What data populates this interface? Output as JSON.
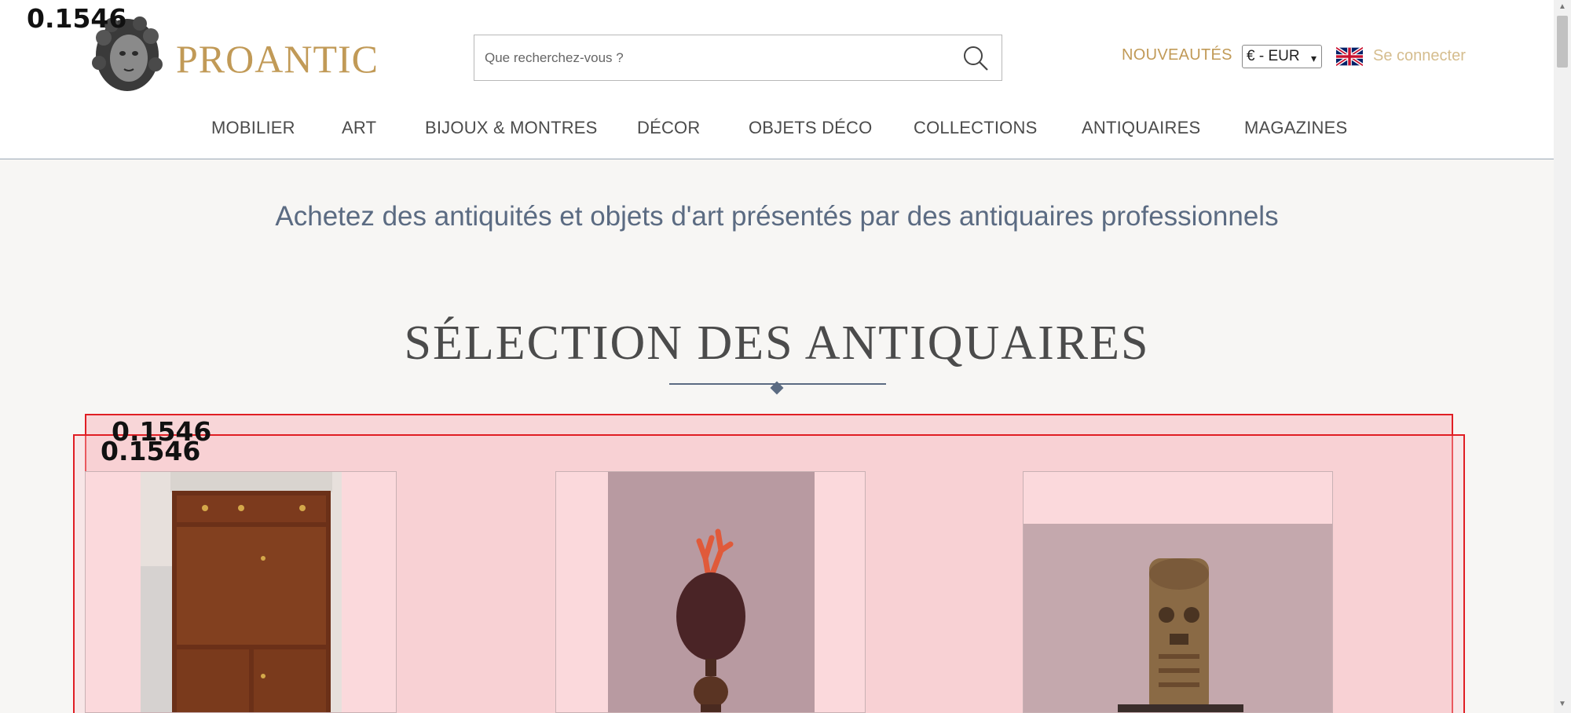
{
  "header": {
    "logo_text": "PROANTIC",
    "search_placeholder": "Que recherchez-vous ?",
    "nouveautes": "NOUVEAUTÉS",
    "currency": "€ - EUR",
    "login": "Se connecter"
  },
  "nav": {
    "items": [
      "MOBILIER",
      "ART",
      "BIJOUX & MONTRES",
      "DÉCOR",
      "OBJETS DÉCO",
      "COLLECTIONS",
      "ANTIQUAIRES",
      "MAGAZINES"
    ]
  },
  "main": {
    "tagline": "Achetez des antiquités et objets d'art présentés par des antiquaires professionnels",
    "section_title": "SÉLECTION DES ANTIQUAIRES"
  },
  "overlays": {
    "score_top": "0.1546",
    "score_box_a": "0.1546",
    "score_box_b": "0.1546"
  },
  "colors": {
    "brand_gold": "#c19a57",
    "nav_text": "#4b4b4b",
    "tagline": "#5b6b82",
    "highlight": "#e01e24"
  }
}
